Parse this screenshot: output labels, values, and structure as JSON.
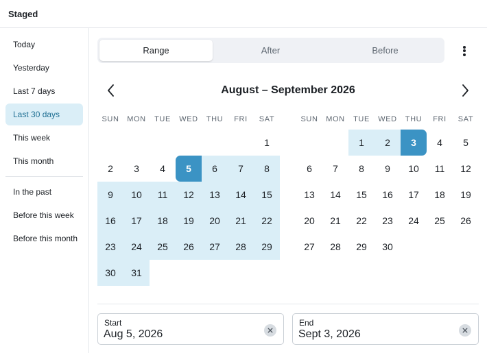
{
  "header": {
    "title": "Staged"
  },
  "sidebar": {
    "items": [
      {
        "label": "Today"
      },
      {
        "label": "Yesterday"
      },
      {
        "label": "Last 7 days"
      },
      {
        "label": "Last 30 days",
        "active": true
      },
      {
        "label": "This week"
      },
      {
        "label": "This month"
      },
      {
        "label": "In the past"
      },
      {
        "label": "Before this week"
      },
      {
        "label": "Before this month"
      }
    ]
  },
  "mode": {
    "tabs": [
      {
        "label": "Range",
        "active": true
      },
      {
        "label": "After"
      },
      {
        "label": "Before"
      }
    ],
    "more_icon": "more-vertical-icon"
  },
  "calendar": {
    "title": "August – September 2026",
    "prev_icon": "chevron-left-icon",
    "next_icon": "chevron-right-icon",
    "weekdays": [
      "SUN",
      "MON",
      "TUE",
      "WED",
      "THU",
      "FRI",
      "SAT"
    ],
    "months": [
      {
        "name": "August 2026",
        "first_weekday": 6,
        "days": 31
      },
      {
        "name": "September 2026",
        "first_weekday": 2,
        "days": 30
      }
    ],
    "range_start": "2026-08-05",
    "range_end": "2026-09-03"
  },
  "fields": {
    "start": {
      "label": "Start",
      "value": "Aug 5, 2026"
    },
    "end": {
      "label": "End",
      "value": "Sept 3, 2026"
    },
    "clear_icon": "clear-icon"
  },
  "colors": {
    "accent": "#3b93c4",
    "range_fill": "#daeef7",
    "active_text": "#1f6f93"
  }
}
